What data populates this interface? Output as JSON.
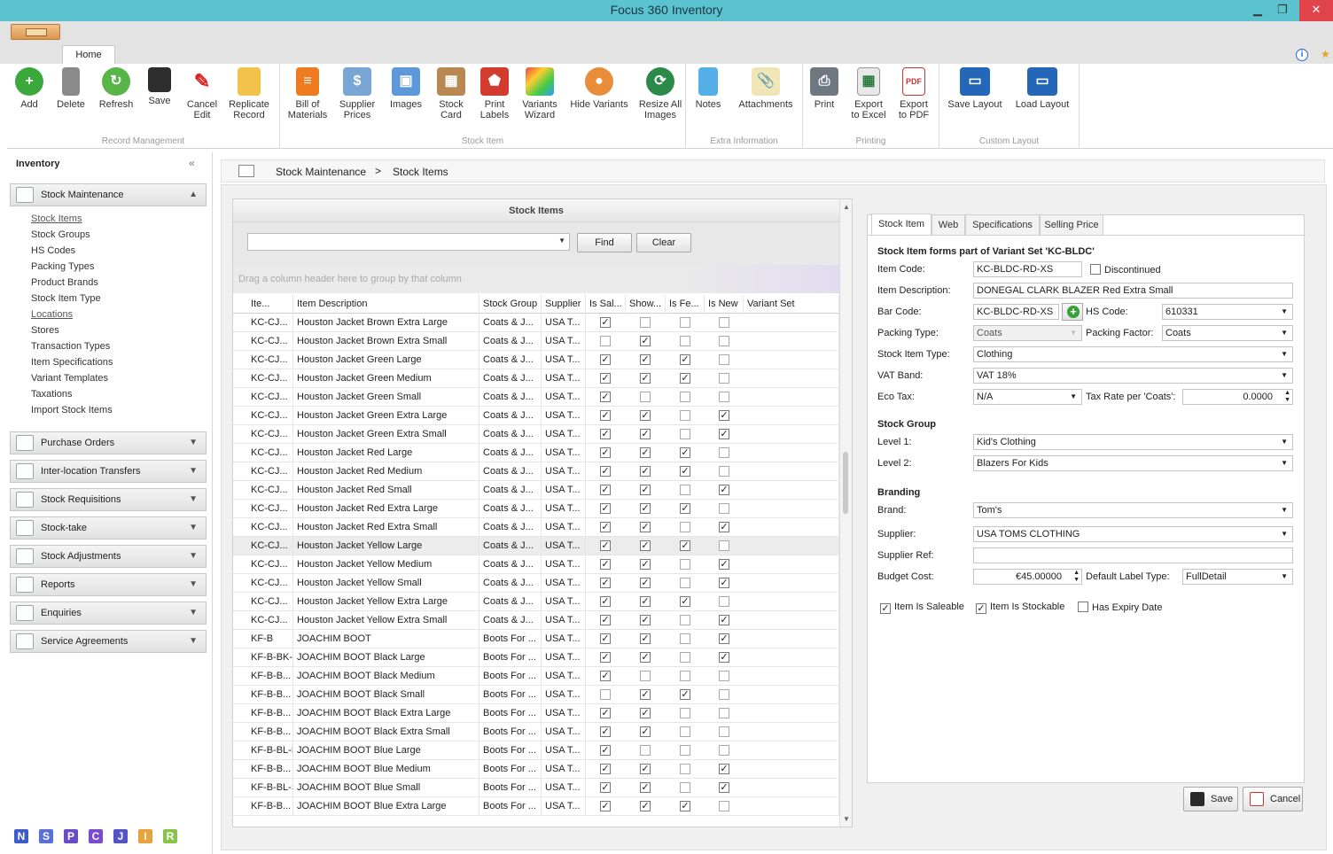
{
  "window": {
    "title": "Focus 360 Inventory",
    "minimize": "▁",
    "restore": "❐",
    "close": "✕"
  },
  "ribbon_tabs": {
    "home": "Home"
  },
  "ribbon": {
    "groups": [
      {
        "caption": "Record Management",
        "buttons": [
          "Add",
          "Delete",
          "Refresh",
          "Save",
          "Cancel\nEdit",
          "Replicate\nRecord"
        ]
      },
      {
        "caption": "Stock Item",
        "buttons": [
          "Bill of\nMaterials",
          "Supplier\nPrices",
          "Images",
          "Stock\nCard",
          "Print\nLabels",
          "Variants\nWizard",
          "Hide Variants",
          "Resize All\nImages"
        ]
      },
      {
        "caption": "Extra Information",
        "buttons": [
          "Notes",
          "Attachments"
        ]
      },
      {
        "caption": "Printing",
        "buttons": [
          "Print",
          "Export\nto Excel",
          "Export\nto PDF"
        ]
      },
      {
        "caption": "Custom Layout",
        "buttons": [
          "Save Layout",
          "Load Layout"
        ]
      }
    ]
  },
  "nav": {
    "title": "Inventory",
    "collapse": "«",
    "stock_maintenance": "Stock Maintenance",
    "sub_items": [
      "Stock Items",
      "Stock Groups",
      "HS Codes",
      "Packing Types",
      "Product Brands",
      "Stock Item Type",
      "Locations",
      "Stores",
      "Transaction Types",
      "Item Specifications",
      "Variant Templates",
      "Taxations",
      "Import Stock Items"
    ],
    "sections": [
      "Purchase Orders",
      "Inter-location Transfers",
      "Stock Requisitions",
      "Stock-take",
      "Stock Adjustments",
      "Reports",
      "Enquiries",
      "Service Agreements"
    ],
    "bottom": [
      "N",
      "S",
      "P",
      "C",
      "J",
      "I",
      "R"
    ]
  },
  "breadcrumb": {
    "first": "Stock Maintenance",
    "sep": ">",
    "second": "Stock Items"
  },
  "grid": {
    "title": "Stock Items",
    "find": "Find",
    "clear": "Clear",
    "group_hint": "Drag a column header here to group by that column",
    "columns": [
      "Ite...",
      "Item Description",
      "Stock Group",
      "Supplier",
      "Is Sal...",
      "Show...",
      "Is Fe...",
      "Is New",
      "Variant Set"
    ],
    "rows": [
      {
        "code": "KC-CJ...",
        "desc": "Houston Jacket Brown Extra Large",
        "group": "Coats & J...",
        "sup": "USA T...",
        "c": [
          1,
          0,
          0,
          0
        ]
      },
      {
        "code": "KC-CJ...",
        "desc": "Houston Jacket Brown Extra Small",
        "group": "Coats & J...",
        "sup": "USA T...",
        "c": [
          0,
          1,
          0,
          0
        ]
      },
      {
        "code": "KC-CJ...",
        "desc": "Houston Jacket Green Large",
        "group": "Coats & J...",
        "sup": "USA T...",
        "c": [
          1,
          1,
          1,
          0
        ]
      },
      {
        "code": "KC-CJ...",
        "desc": "Houston Jacket Green Medium",
        "group": "Coats & J...",
        "sup": "USA T...",
        "c": [
          1,
          1,
          1,
          0
        ]
      },
      {
        "code": "KC-CJ...",
        "desc": "Houston Jacket Green Small",
        "group": "Coats & J...",
        "sup": "USA T...",
        "c": [
          1,
          0,
          0,
          0
        ]
      },
      {
        "code": "KC-CJ...",
        "desc": "Houston Jacket Green Extra Large",
        "group": "Coats & J...",
        "sup": "USA T...",
        "c": [
          1,
          1,
          0,
          1
        ]
      },
      {
        "code": "KC-CJ...",
        "desc": "Houston Jacket Green Extra Small",
        "group": "Coats & J...",
        "sup": "USA T...",
        "c": [
          1,
          1,
          0,
          1
        ]
      },
      {
        "code": "KC-CJ...",
        "desc": "Houston Jacket Red Large",
        "group": "Coats & J...",
        "sup": "USA T...",
        "c": [
          1,
          1,
          1,
          0
        ]
      },
      {
        "code": "KC-CJ...",
        "desc": "Houston Jacket Red Medium",
        "group": "Coats & J...",
        "sup": "USA T...",
        "c": [
          1,
          1,
          1,
          0
        ]
      },
      {
        "code": "KC-CJ...",
        "desc": "Houston Jacket Red Small",
        "group": "Coats & J...",
        "sup": "USA T...",
        "c": [
          1,
          1,
          0,
          1
        ]
      },
      {
        "code": "KC-CJ...",
        "desc": "Houston Jacket Red Extra Large",
        "group": "Coats & J...",
        "sup": "USA T...",
        "c": [
          1,
          1,
          1,
          0
        ]
      },
      {
        "code": "KC-CJ...",
        "desc": "Houston Jacket Red Extra Small",
        "group": "Coats & J...",
        "sup": "USA T...",
        "c": [
          1,
          1,
          0,
          1
        ]
      },
      {
        "code": "KC-CJ...",
        "desc": "Houston Jacket Yellow Large",
        "group": "Coats & J...",
        "sup": "USA T...",
        "c": [
          1,
          1,
          1,
          0
        ]
      },
      {
        "code": "KC-CJ...",
        "desc": "Houston Jacket Yellow Medium",
        "group": "Coats & J...",
        "sup": "USA T...",
        "c": [
          1,
          1,
          0,
          1
        ]
      },
      {
        "code": "KC-CJ...",
        "desc": "Houston Jacket Yellow Small",
        "group": "Coats & J...",
        "sup": "USA T...",
        "c": [
          1,
          1,
          0,
          1
        ]
      },
      {
        "code": "KC-CJ...",
        "desc": "Houston Jacket Yellow Extra Large",
        "group": "Coats & J...",
        "sup": "USA T...",
        "c": [
          1,
          1,
          1,
          0
        ]
      },
      {
        "code": "KC-CJ...",
        "desc": "Houston Jacket Yellow Extra Small",
        "group": "Coats & J...",
        "sup": "USA T...",
        "c": [
          1,
          1,
          0,
          1
        ]
      },
      {
        "code": "KF-B",
        "desc": "JOACHIM BOOT",
        "group": "Boots For ...",
        "sup": "USA T...",
        "c": [
          1,
          1,
          0,
          1
        ]
      },
      {
        "code": "KF-B-BK-L",
        "desc": "JOACHIM BOOT Black Large",
        "group": "Boots For ...",
        "sup": "USA T...",
        "c": [
          1,
          1,
          0,
          1
        ]
      },
      {
        "code": "KF-B-B...",
        "desc": "JOACHIM BOOT Black Medium",
        "group": "Boots For ...",
        "sup": "USA T...",
        "c": [
          1,
          0,
          0,
          0
        ]
      },
      {
        "code": "KF-B-B...",
        "desc": "JOACHIM BOOT Black Small",
        "group": "Boots For ...",
        "sup": "USA T...",
        "c": [
          0,
          1,
          1,
          0
        ]
      },
      {
        "code": "KF-B-B...",
        "desc": "JOACHIM BOOT Black Extra Large",
        "group": "Boots For ...",
        "sup": "USA T...",
        "c": [
          1,
          1,
          0,
          0
        ]
      },
      {
        "code": "KF-B-B...",
        "desc": "JOACHIM BOOT Black Extra Small",
        "group": "Boots For ...",
        "sup": "USA T...",
        "c": [
          1,
          1,
          0,
          0
        ]
      },
      {
        "code": "KF-B-BL-L",
        "desc": "JOACHIM BOOT Blue Large",
        "group": "Boots For ...",
        "sup": "USA T...",
        "c": [
          1,
          0,
          0,
          0
        ]
      },
      {
        "code": "KF-B-B...",
        "desc": "JOACHIM BOOT Blue Medium",
        "group": "Boots For ...",
        "sup": "USA T...",
        "c": [
          1,
          1,
          0,
          1
        ]
      },
      {
        "code": "KF-B-BL-S",
        "desc": "JOACHIM BOOT Blue Small",
        "group": "Boots For ...",
        "sup": "USA T...",
        "c": [
          1,
          1,
          0,
          1
        ]
      },
      {
        "code": "KF-B-B...",
        "desc": "JOACHIM BOOT Blue Extra Large",
        "group": "Boots For ...",
        "sup": "USA T...",
        "c": [
          1,
          1,
          1,
          0
        ]
      }
    ]
  },
  "detail": {
    "tabs": [
      "Stock Item",
      "Web",
      "Specifications",
      "Selling Price"
    ],
    "variant_note": "Stock Item forms part of Variant Set 'KC-BLDC'",
    "labels": {
      "item_code": "Item Code:",
      "item_desc": "Item Description:",
      "bar_code": "Bar Code:",
      "hs_code": "HS Code:",
      "packing_type": "Packing Type:",
      "packing_factor": "Packing Factor:",
      "stock_item_type": "Stock Item Type:",
      "vat_band": "VAT Band:",
      "eco_tax": "Eco Tax:",
      "tax_rate": "Tax Rate per 'Coats':",
      "stock_group": "Stock Group",
      "level1": "Level 1:",
      "level2": "Level 2:",
      "branding": "Branding",
      "brand": "Brand:",
      "supplier": "Supplier:",
      "supplier_ref": "Supplier Ref:",
      "budget_cost": "Budget Cost:",
      "default_label": "Default Label Type:",
      "discontinued": "Discontinued",
      "saleable": "Item Is Saleable",
      "stockable": "Item Is Stockable",
      "expiry": "Has Expiry Date"
    },
    "values": {
      "item_code": "KC-BLDC-RD-XS",
      "item_desc": "DONEGAL CLARK BLAZER Red Extra Small",
      "bar_code": "KC-BLDC-RD-XS",
      "hs_code": "610331",
      "packing_type": "Coats",
      "packing_factor": "Coats",
      "stock_item_type": "Clothing",
      "vat_band": "VAT 18%",
      "eco_tax": "N/A",
      "tax_rate": "0.0000",
      "level1": "Kid's Clothing",
      "level2": "Blazers For Kids",
      "brand": "Tom's",
      "supplier": "USA TOMS CLOTHING",
      "supplier_ref": "",
      "budget_cost": "€45.00000",
      "default_label": "FullDetail"
    },
    "save": "Save",
    "cancel": "Cancel"
  }
}
